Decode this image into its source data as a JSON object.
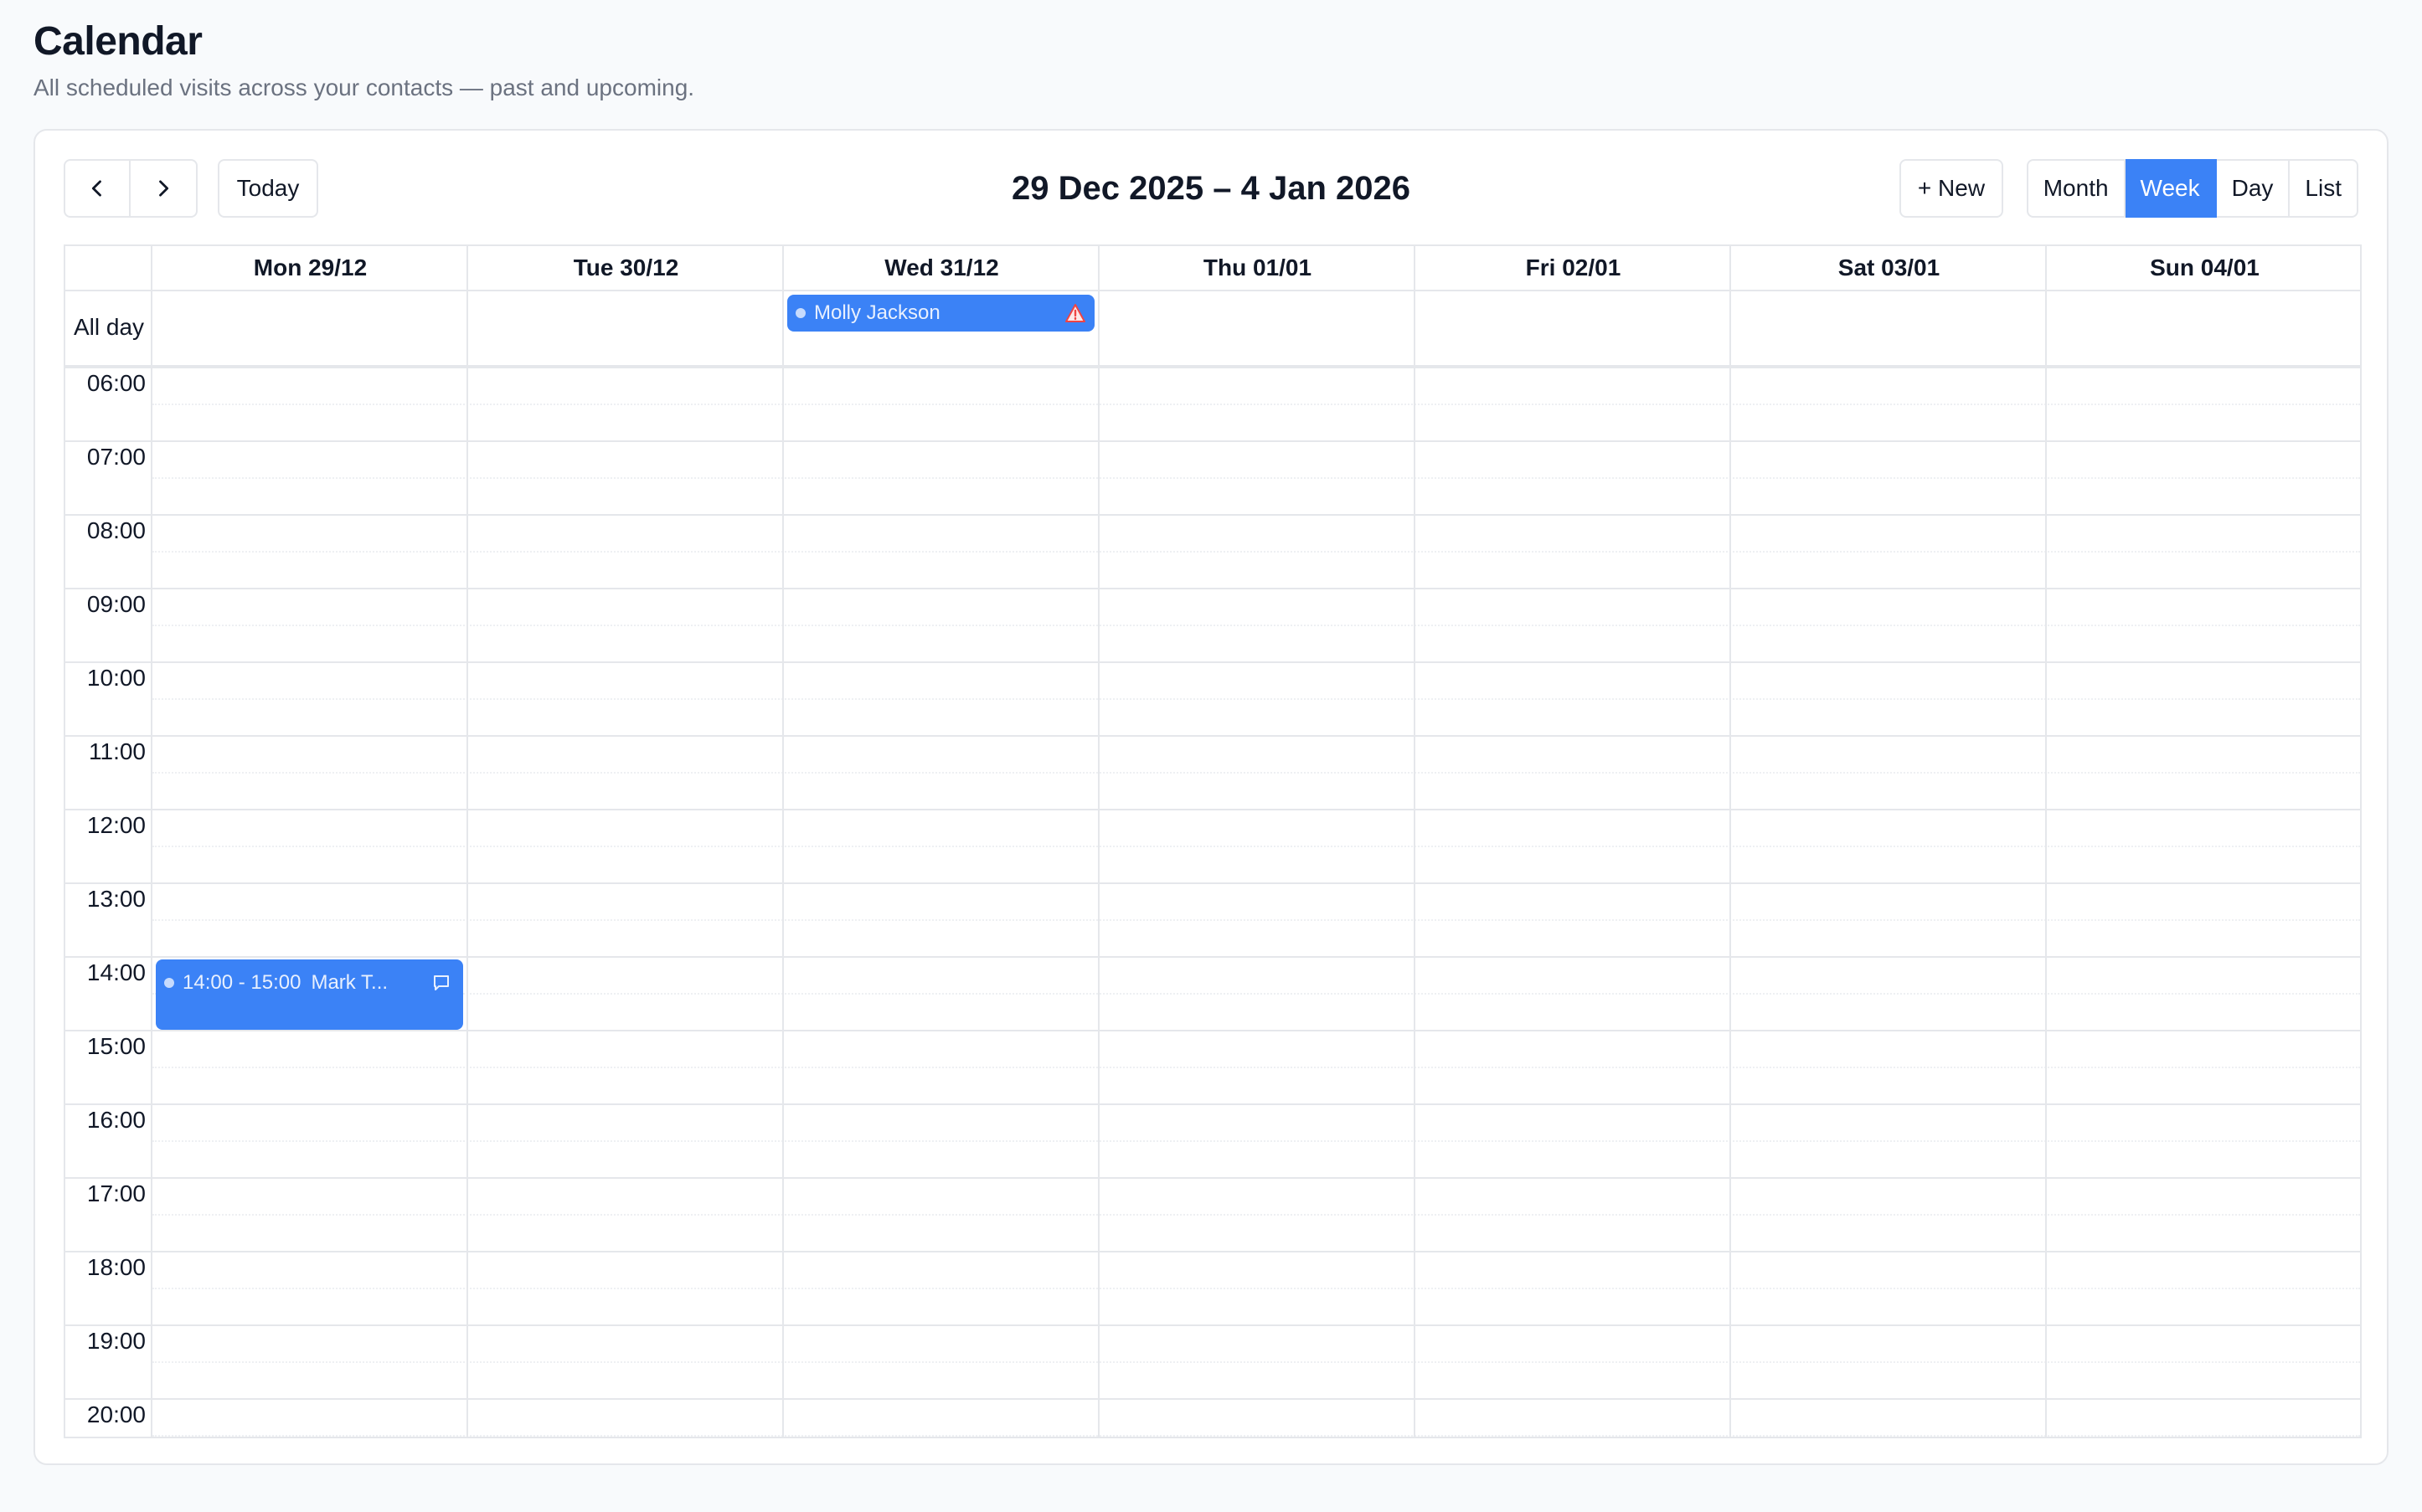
{
  "page": {
    "title": "Calendar",
    "subtitle": "All scheduled visits across your contacts — past and upcoming."
  },
  "toolbar": {
    "prev_icon": "chevron-left-icon",
    "next_icon": "chevron-right-icon",
    "today_label": "Today",
    "range_title": "29 Dec 2025 – 4 Jan 2026",
    "new_label": "+ New",
    "views": [
      "Month",
      "Week",
      "Day",
      "List"
    ],
    "active_view": "Week"
  },
  "calendar": {
    "all_day_label": "All day",
    "days": [
      "Mon 29/12",
      "Tue 30/12",
      "Wed 31/12",
      "Thu 01/01",
      "Fri 02/01",
      "Sat 03/01",
      "Sun 04/01"
    ],
    "hours": [
      "06:00",
      "07:00",
      "08:00",
      "09:00",
      "10:00",
      "11:00",
      "12:00",
      "13:00",
      "14:00",
      "15:00",
      "16:00",
      "17:00",
      "18:00",
      "19:00",
      "20:00"
    ],
    "all_day_events": [
      {
        "day": "Wed 31/12",
        "title": "Molly Jackson",
        "icon": "warning-icon"
      }
    ],
    "timed_events": [
      {
        "day": "Mon 29/12",
        "time": "14:00 - 15:00",
        "start": "14:00",
        "end": "15:00",
        "title": "Mark T...",
        "icon": "chat-icon"
      }
    ]
  },
  "colors": {
    "accent": "#3b82f6",
    "border": "#e5e7eb",
    "warning": "#ef4444"
  }
}
